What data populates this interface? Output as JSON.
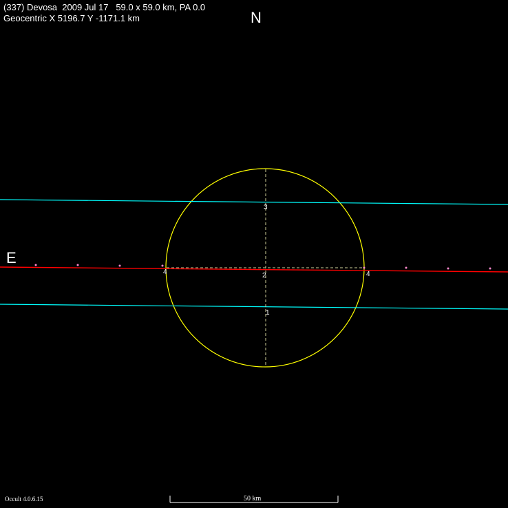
{
  "header": {
    "line1": "(337) Devosa  2009 Jul 17   59.0 x 59.0 km, PA 0.0",
    "line2": "Geocentric X 5196.7 Y -1171.1 km"
  },
  "directions": {
    "north": "N",
    "east": "E"
  },
  "footer": {
    "version": "Occult 4.0.6.15"
  },
  "scale_bar": {
    "label": "50 km",
    "length_km": 50
  },
  "asteroid": {
    "diameter_km": 59.0,
    "pa_deg": 0.0,
    "outline_color": "#ffff00"
  },
  "chords": [
    {
      "label": "1",
      "color": "#00ffff",
      "type": "miss"
    },
    {
      "label": "2",
      "color": "#ff0000",
      "type": "occultation"
    },
    {
      "label": "3",
      "color": "#00ffff",
      "type": "miss"
    },
    {
      "label": "4",
      "color": "#ff0000",
      "type": "event"
    }
  ],
  "colors": {
    "background": "#000000",
    "dashed_lines": "#cfcf9a",
    "dots": "#ff88cc"
  }
}
